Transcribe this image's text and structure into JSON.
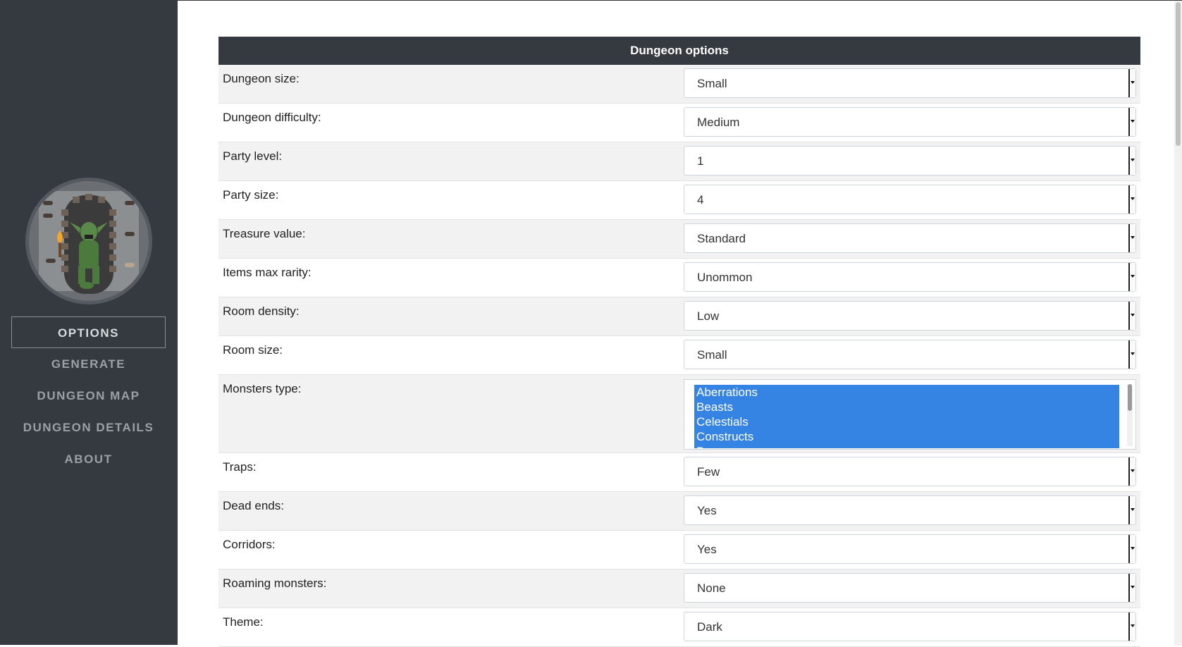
{
  "sidebar": {
    "nav": [
      {
        "label": "OPTIONS",
        "active": true
      },
      {
        "label": "GENERATE",
        "active": false
      },
      {
        "label": "DUNGEON MAP",
        "active": false
      },
      {
        "label": "DUNGEON DETAILS",
        "active": false
      },
      {
        "label": "ABOUT",
        "active": false
      }
    ]
  },
  "panel": {
    "title": "Dungeon options",
    "rows": [
      {
        "label": "Dungeon size:",
        "value": "Small"
      },
      {
        "label": "Dungeon difficulty:",
        "value": "Medium"
      },
      {
        "label": "Party level:",
        "value": "1"
      },
      {
        "label": "Party size:",
        "value": "4"
      },
      {
        "label": "Treasure value:",
        "value": "Standard"
      },
      {
        "label": "Items max rarity:",
        "value": "Unommon"
      },
      {
        "label": "Room density:",
        "value": "Low"
      },
      {
        "label": "Room size:",
        "value": "Small"
      },
      {
        "label": "Monsters type:",
        "options": [
          "Aberrations",
          "Beasts",
          "Celestials",
          "Constructs",
          "D"
        ]
      },
      {
        "label": "Traps:",
        "value": "Few"
      },
      {
        "label": "Dead ends:",
        "value": "Yes"
      },
      {
        "label": "Corridors:",
        "value": "Yes"
      },
      {
        "label": "Roaming monsters:",
        "value": "None"
      },
      {
        "label": "Theme:",
        "value": "Dark"
      }
    ]
  },
  "colors": {
    "sidebar_bg": "#343a40",
    "selection": "#3584e4"
  }
}
